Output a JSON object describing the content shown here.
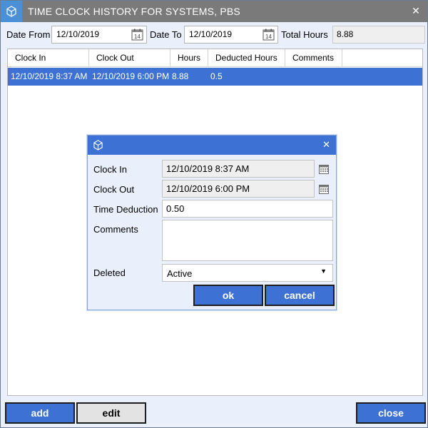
{
  "window": {
    "title": "TIME CLOCK HISTORY FOR SYSTEMS, PBS",
    "icon": "cube-icon",
    "close_icon": "close-icon"
  },
  "filters": {
    "date_from_label": "Date From",
    "date_from_value": "12/10/2019",
    "date_to_label": "Date To",
    "date_to_value": "12/10/2019",
    "calendar_icon": "calendar-icon",
    "calendar_day": "14",
    "total_hours_label": "Total Hours",
    "total_hours_value": "8.88"
  },
  "grid": {
    "columns": [
      "Clock In",
      "Clock Out",
      "Hours",
      "Deducted Hours",
      "Comments"
    ],
    "rows": [
      {
        "clock_in": "12/10/2019 8:37 AM",
        "clock_out": "12/10/2019 6:00 PM",
        "hours": "8.88",
        "deducted": "0.5",
        "comments": ""
      }
    ]
  },
  "dialog": {
    "clock_in_label": "Clock In",
    "clock_in_value": "12/10/2019 8:37 AM",
    "clock_out_label": "Clock Out",
    "clock_out_value": "12/10/2019 6:00 PM",
    "time_deduction_label": "Time Deduction",
    "time_deduction_value": "0.50",
    "comments_label": "Comments",
    "comments_value": "",
    "deleted_label": "Deleted",
    "deleted_value": "Active",
    "ok_label": "ok",
    "cancel_label": "cancel"
  },
  "footer": {
    "add_label": "add",
    "edit_label": "edit",
    "close_label": "close"
  },
  "colors": {
    "accent": "#3d72d4",
    "titlebar": "#7a7a7a",
    "background": "#e9f0fb"
  }
}
